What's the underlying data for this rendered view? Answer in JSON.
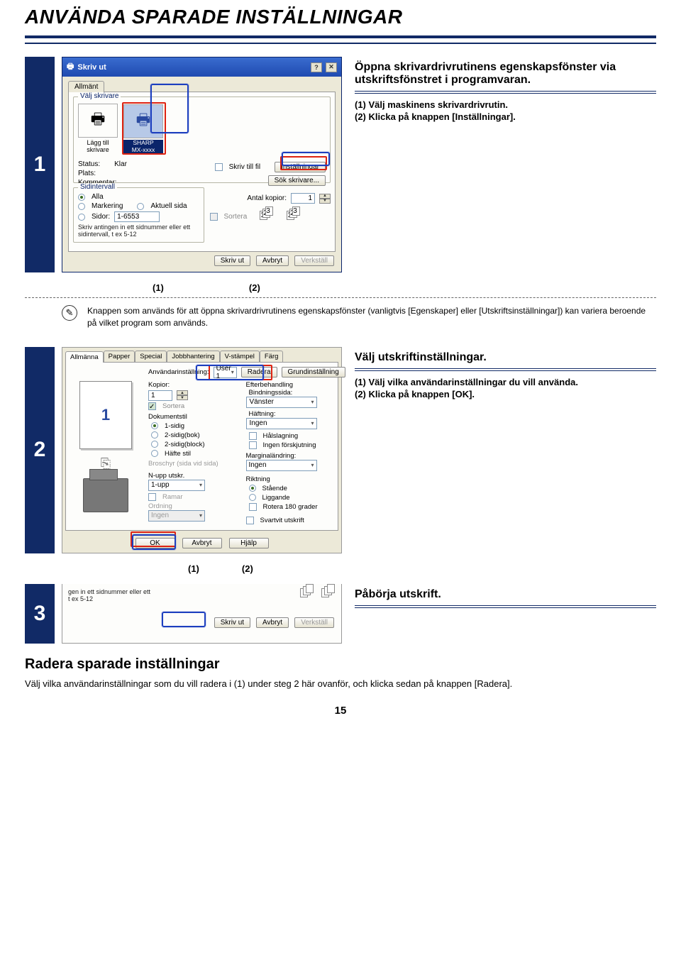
{
  "title": "ANVÄNDA SPARADE INSTÄLLNINGAR",
  "step1": {
    "num": "1",
    "lead": "Öppna skrivardrivrutinens egenskapsfönster via utskriftsfönstret i programvaran.",
    "line1": "(1) Välj maskinens skrivardrivrutin.",
    "line2": "(2) Klicka på knappen [Inställningar].",
    "callout1": "(1)",
    "callout2": "(2)"
  },
  "note": {
    "text": "Knappen som används för att öppna skrivardrivrutinens egenskapsfönster (vanligtvis [Egenskaper] eller [Utskriftsinställningar]) kan variera beroende på vilket program som används."
  },
  "dlg1": {
    "title": "Skriv ut",
    "tab": "Allmänt",
    "grp_printer": "Välj skrivare",
    "add_printer": "Lägg till skrivare",
    "printer_name1": "SHARP",
    "printer_name2": "MX-xxxx",
    "status_l": "Status:",
    "status_v": "Klar",
    "plats_l": "Plats:",
    "komment_l": "Kommentar:",
    "tofile": "Skriv till fil",
    "settings_btn": "Inställningar",
    "search_btn": "Sök skrivare...",
    "grp_range": "Sidintervall",
    "r_all": "Alla",
    "r_mark": "Markering",
    "r_current": "Aktuell sida",
    "r_pages": "Sidor:",
    "pages_val": "1-6553",
    "hint1": "Skriv antingen in ett sidnummer eller ett",
    "hint2": "sidintervall, t ex 5-12",
    "copies_l": "Antal kopior:",
    "copies_v": "1",
    "collate": "Sortera",
    "print_btn": "Skriv ut",
    "cancel_btn": "Avbryt",
    "apply_btn": "Verkställ"
  },
  "step2": {
    "num": "2",
    "lead": "Välj utskriftinställningar.",
    "line1": "(1) Välj vilka användarinställningar du vill använda.",
    "line2": "(2) Klicka på knappen [OK].",
    "callout1": "(1)",
    "callout2": "(2)"
  },
  "dlg2": {
    "tabs": [
      "Allmänna",
      "Papper",
      "Special",
      "Jobbhantering",
      "V-stämpel",
      "Färg"
    ],
    "user_l": "Användarinställning:",
    "user_v": "User 1",
    "delete_btn": "Radera",
    "default_btn": "Grundinställning",
    "copies_l": "Kopior:",
    "copies_v": "1",
    "sort": "Sortera",
    "docstyle_l": "Dokumentstil",
    "ds1": "1-sidig",
    "ds2": "2-sidig(bok)",
    "ds3": "2-sidig(block)",
    "ds4": "Häfte stil",
    "brochure_l": "Broschyr (sida vid sida)",
    "nup_l": "N-upp utskr.",
    "nup_v": "1-upp",
    "frames": "Ramar",
    "order_l": "Ordning",
    "order_v": "Ingen",
    "finish_l": "Efterbehandling",
    "bind_l": "Bindningssida:",
    "bind_v": "Vänster",
    "staple_l": "Häftning:",
    "staple_v": "Ingen",
    "punch": "Hålslagning",
    "offset": "Ingen förskjutning",
    "margin_l": "Marginaländring:",
    "margin_v": "Ingen",
    "orient_l": "Riktning",
    "o1": "Stående",
    "o2": "Liggande",
    "o3": "Rotera 180 grader",
    "bw": "Svartvit utskrift",
    "ok": "OK",
    "cancel": "Avbryt",
    "help": "Hjälp",
    "preview_digit": "1"
  },
  "step3": {
    "num": "3",
    "lead": "Påbörja utskrift.",
    "hint1": "gen in ett sidnummer eller ett",
    "hint2": "t ex 5-12",
    "print_btn": "Skriv ut",
    "cancel_btn": "Avbryt",
    "apply_btn": "Verkställ"
  },
  "sec4_title": "Radera sparade inställningar",
  "sec4_text": "Välj vilka användarinställningar som du vill radera i (1) under steg 2 här ovanför, och klicka sedan på knappen [Radera].",
  "page_num": "15"
}
